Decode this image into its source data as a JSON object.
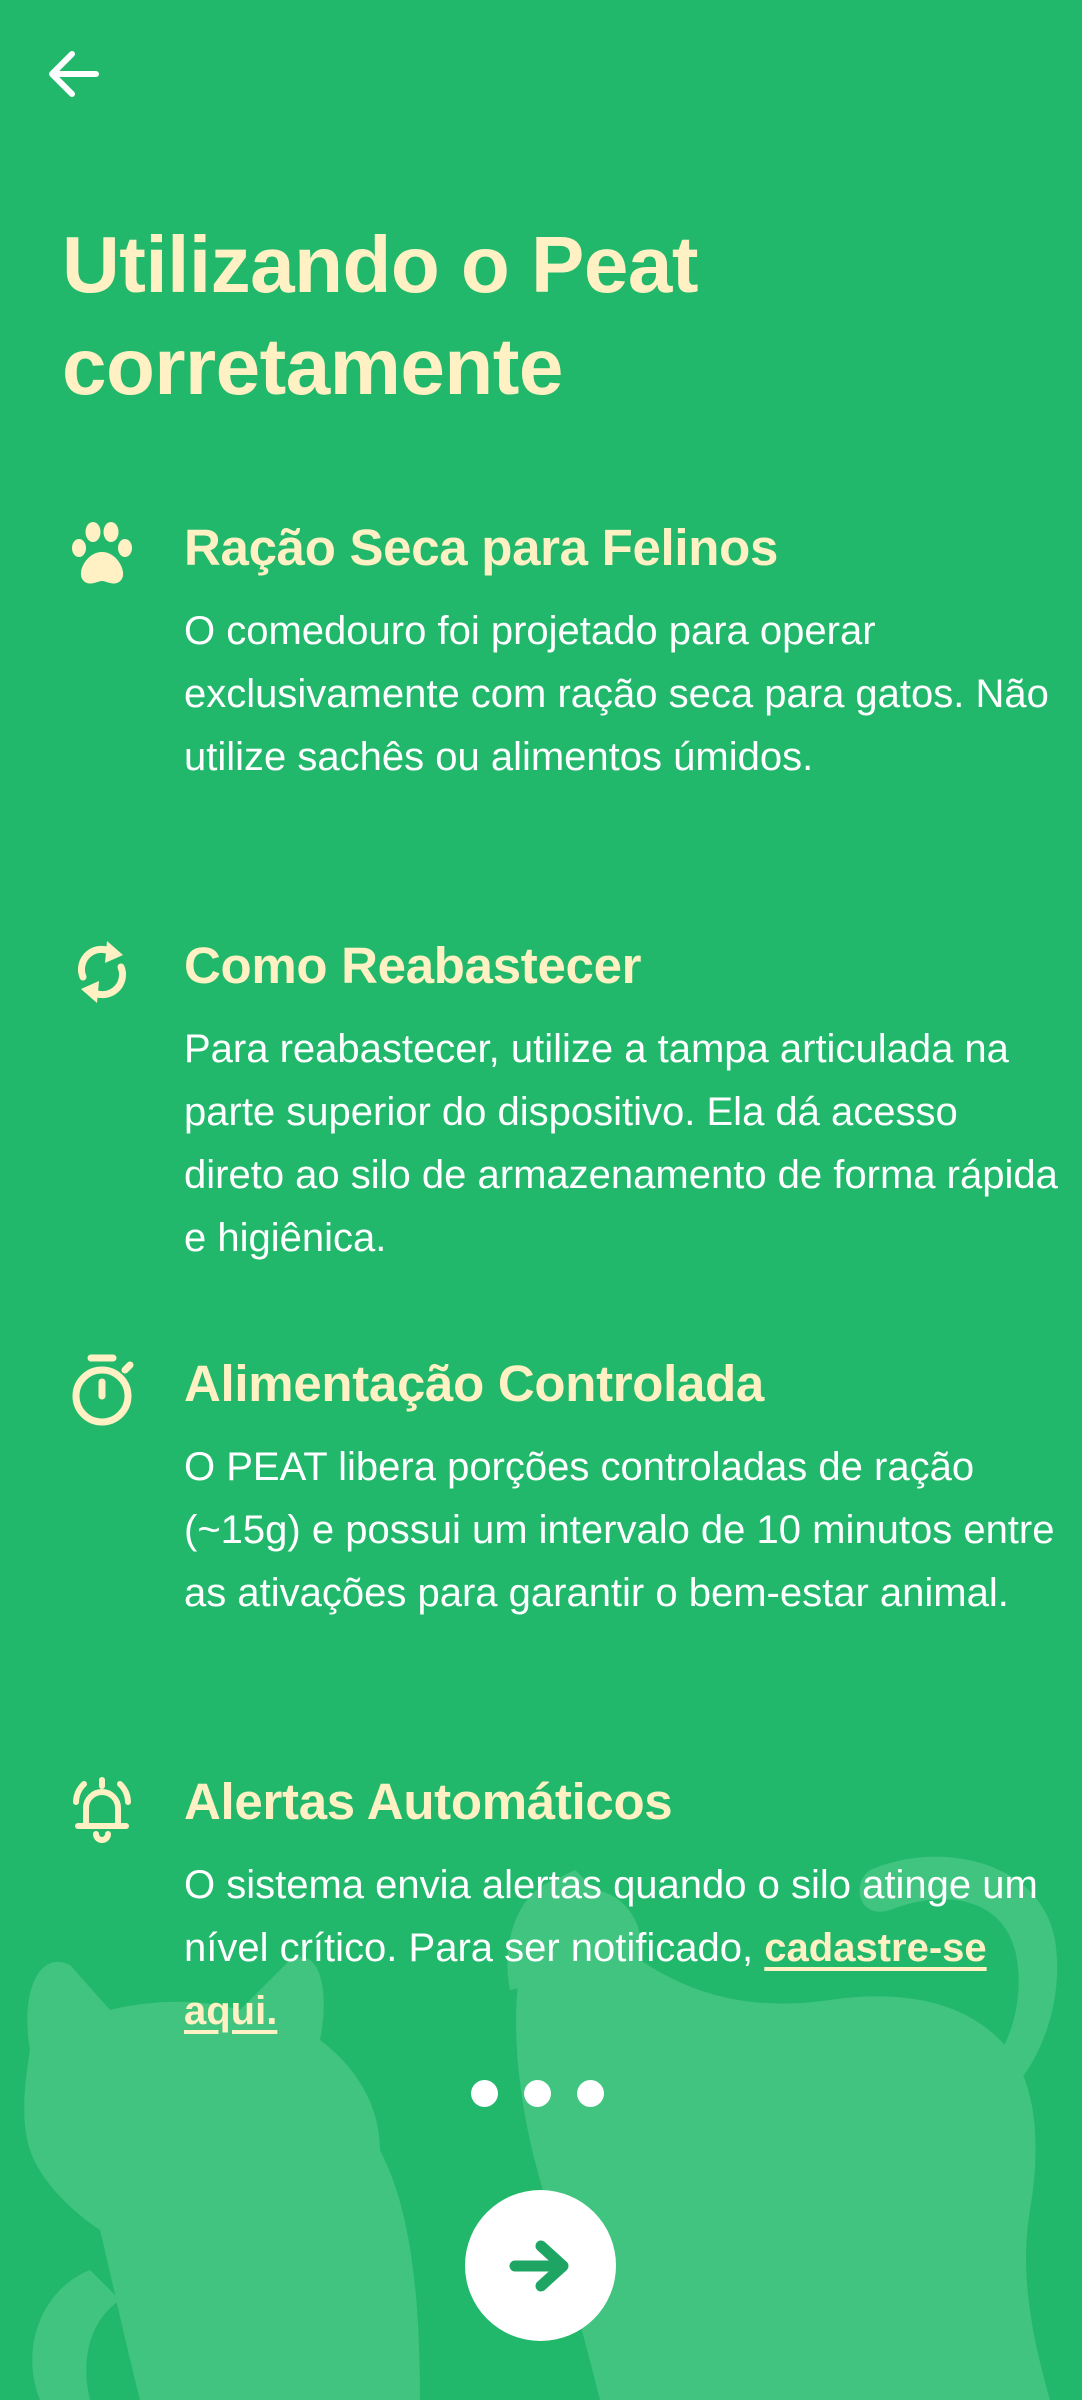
{
  "header": {
    "back_icon": "arrow-left-icon",
    "title": "Utilizando o Peat\ncorretamente"
  },
  "sections": [
    {
      "icon": "paw-icon",
      "heading": "Ração Seca para Felinos",
      "body": "O comedouro foi projetado para operar exclusivamente com ração seca para gatos. Não utilize sachês ou alimentos úmidos."
    },
    {
      "icon": "refresh-icon",
      "heading": "Como Reabastecer",
      "body": "Para reabastecer, utilize a tampa articulada na parte superior do dispositivo. Ela dá acesso direto ao silo de armazenamento de forma rápida e higiênica."
    },
    {
      "icon": "stopwatch-icon",
      "heading": "Alimentação Controlada",
      "body": "O PEAT libera porções controladas de ração (~15g) e possui um intervalo de 10 minutos entre as ativações para garantir o bem-estar animal."
    },
    {
      "icon": "alarm-bell-icon",
      "heading": "Alertas Automáticos",
      "body": "O sistema envia alertas quando o silo atinge um nível crítico. Para ser notificado,",
      "link_label": "cadastre-se aqui."
    }
  ],
  "pagination": {
    "total": 3
  },
  "footer": {
    "next_icon": "arrow-right-icon"
  },
  "colors": {
    "background": "#22b86c",
    "accent_cream": "#fff1c3",
    "body_text": "#ffffff",
    "cat_silhouette": "#40c47f",
    "next_arrow": "#1ea563"
  }
}
